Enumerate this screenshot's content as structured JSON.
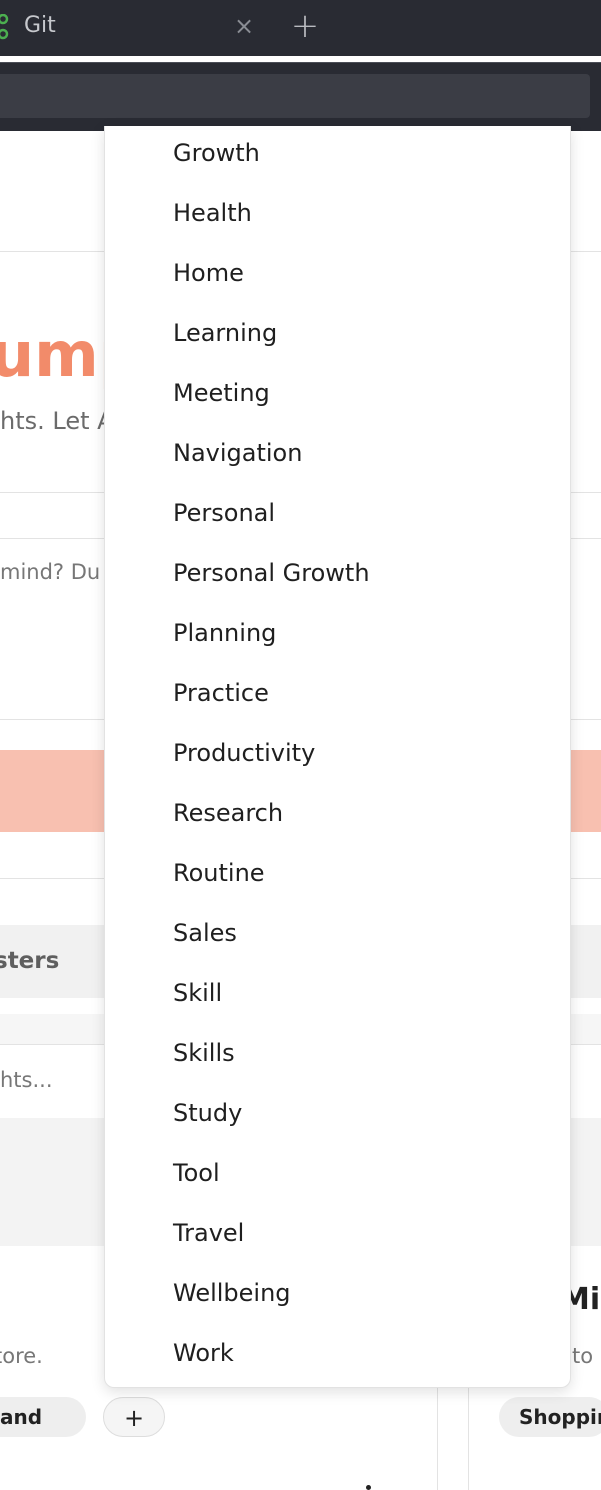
{
  "browser": {
    "tab_title": "Git",
    "tab_close": "×",
    "new_tab": "+"
  },
  "page": {
    "hero_title": "ump",
    "hero_subtitle": "hts. Let A",
    "prompt_text": "mind? Du",
    "clusters_label": "sters",
    "search_text": "hts...",
    "card_right_title": "Mil",
    "card_left_desc": "tore.",
    "card_right_desc": "to",
    "pill_left": "and",
    "pill_add": "+",
    "pill_right": "Shoppin"
  },
  "dropdown": {
    "items": [
      "Growth",
      "Health",
      "Home",
      "Learning",
      "Meeting",
      "Navigation",
      "Personal",
      "Personal Growth",
      "Planning",
      "Practice",
      "Productivity",
      "Research",
      "Routine",
      "Sales",
      "Skill",
      "Skills",
      "Study",
      "Tool",
      "Travel",
      "Wellbeing",
      "Work"
    ]
  },
  "colors": {
    "accent": "#f28b6a",
    "pink_bar": "#f8c0b0",
    "chrome_bg": "#292b33"
  }
}
